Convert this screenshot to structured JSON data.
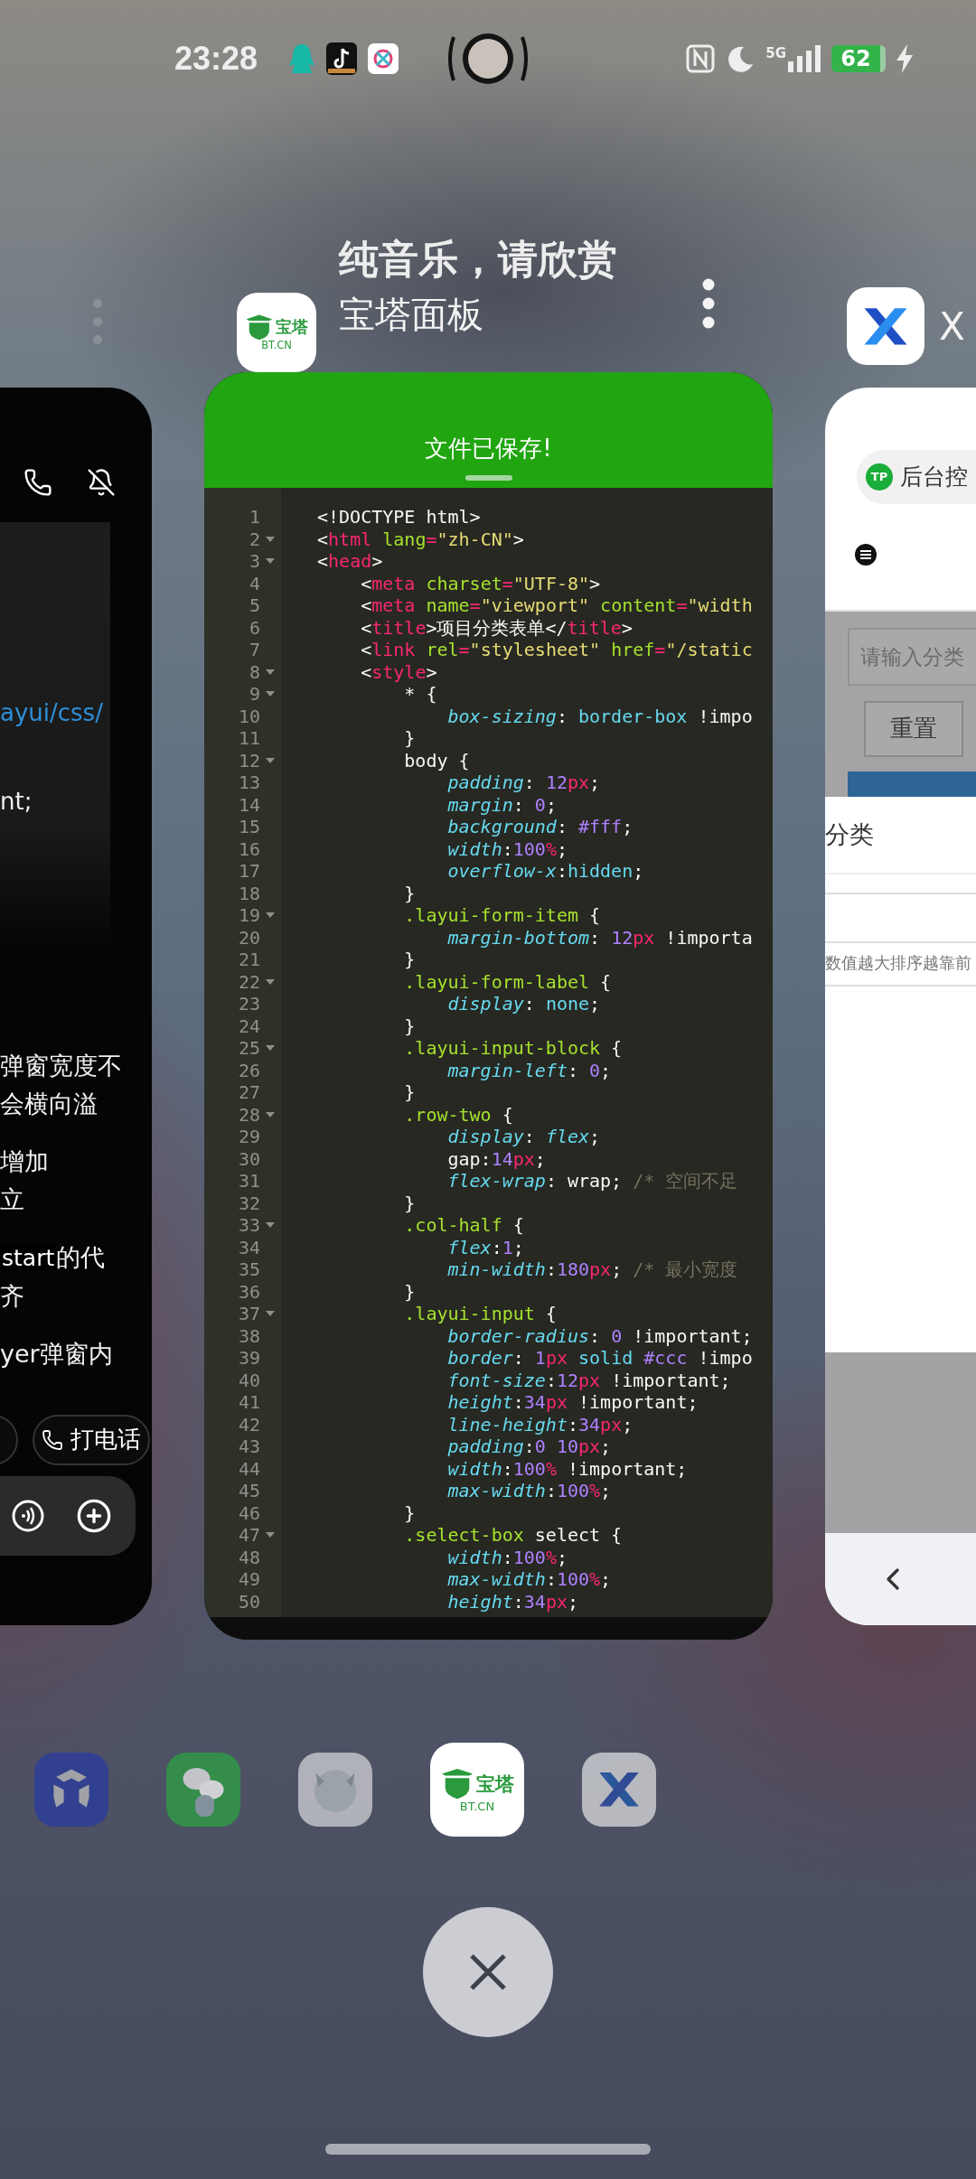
{
  "status_bar": {
    "time": "23:28",
    "network": "5G",
    "battery": "62"
  },
  "current_app": {
    "title": "纯音乐，请欣赏",
    "name": "宝塔面板",
    "icon_mark": "宝塔",
    "icon_domain": "BT.CN"
  },
  "next_app": {
    "name": "X"
  },
  "left_card": {
    "link_text": "ayui/css/",
    "code_tail": "nt;",
    "paragraphs": [
      [
        {
          "text": "弹窗宽度不"
        },
        {
          "text": "会横向溢"
        }
      ],
      [
        {
          "text": "增加"
        },
        {
          "text": "立"
        }
      ],
      [
        {
          "code": "start",
          "text": "的代"
        },
        {
          "text": "齐"
        }
      ],
      [
        {
          "text": "yer弹窗内"
        }
      ]
    ],
    "call_button": "打电话"
  },
  "editor": {
    "toast": "文件已保存!",
    "lines": [
      {
        "n": "1",
        "fold": false,
        "tokens": [
          {
            "kind": "plain",
            "text": "<!DOCTYPE html>"
          }
        ]
      },
      {
        "n": "2",
        "fold": true,
        "tokens": [
          {
            "kind": "plain",
            "text": "<"
          },
          {
            "kind": "tag",
            "text": "html"
          },
          {
            "kind": "attr",
            "text": " lang"
          },
          {
            "kind": "tag",
            "text": "="
          },
          {
            "kind": "str",
            "text": "\"zh-CN\""
          },
          {
            "kind": "plain",
            "text": ">"
          }
        ]
      },
      {
        "n": "3",
        "fold": true,
        "tokens": [
          {
            "kind": "plain",
            "text": "<"
          },
          {
            "kind": "tag",
            "text": "head"
          },
          {
            "kind": "plain",
            "text": ">"
          }
        ]
      },
      {
        "n": "4",
        "fold": false,
        "tokens": [
          {
            "kind": "plain",
            "text": "    <"
          },
          {
            "kind": "tag",
            "text": "meta"
          },
          {
            "kind": "attr",
            "text": " charset"
          },
          {
            "kind": "tag",
            "text": "="
          },
          {
            "kind": "str",
            "text": "\"UTF-8\""
          },
          {
            "kind": "plain",
            "text": ">"
          }
        ]
      },
      {
        "n": "5",
        "fold": false,
        "tokens": [
          {
            "kind": "plain",
            "text": "    <"
          },
          {
            "kind": "tag",
            "text": "meta"
          },
          {
            "kind": "attr",
            "text": " name"
          },
          {
            "kind": "tag",
            "text": "="
          },
          {
            "kind": "str",
            "text": "\"viewport\""
          },
          {
            "kind": "attr",
            "text": " content"
          },
          {
            "kind": "tag",
            "text": "="
          },
          {
            "kind": "str",
            "text": "\"width"
          }
        ]
      },
      {
        "n": "6",
        "fold": false,
        "tokens": [
          {
            "kind": "plain",
            "text": "    <"
          },
          {
            "kind": "tag",
            "text": "title"
          },
          {
            "kind": "plain",
            "text": ">项目分类表单</"
          },
          {
            "kind": "tag",
            "text": "title"
          },
          {
            "kind": "plain",
            "text": ">"
          }
        ]
      },
      {
        "n": "7",
        "fold": false,
        "tokens": [
          {
            "kind": "plain",
            "text": "    <"
          },
          {
            "kind": "tag",
            "text": "link"
          },
          {
            "kind": "attr",
            "text": " rel"
          },
          {
            "kind": "tag",
            "text": "="
          },
          {
            "kind": "str",
            "text": "\"stylesheet\""
          },
          {
            "kind": "attr",
            "text": " href"
          },
          {
            "kind": "tag",
            "text": "="
          },
          {
            "kind": "str",
            "text": "\"/static"
          }
        ]
      },
      {
        "n": "8",
        "fold": true,
        "tokens": [
          {
            "kind": "plain",
            "text": "    <"
          },
          {
            "kind": "tag",
            "text": "style"
          },
          {
            "kind": "plain",
            "text": ">"
          }
        ]
      },
      {
        "n": "9",
        "fold": true,
        "tokens": [
          {
            "kind": "plain",
            "text": "        * {"
          }
        ]
      },
      {
        "n": "10",
        "fold": false,
        "tokens": [
          {
            "kind": "prop",
            "text": "            box-sizing"
          },
          {
            "kind": "plain",
            "text": ": "
          },
          {
            "kind": "val",
            "text": "border-box"
          },
          {
            "kind": "plain",
            "text": " !impo"
          }
        ]
      },
      {
        "n": "11",
        "fold": false,
        "tokens": [
          {
            "kind": "plain",
            "text": "        }"
          }
        ]
      },
      {
        "n": "12",
        "fold": true,
        "tokens": [
          {
            "kind": "plain",
            "text": "        body {"
          }
        ]
      },
      {
        "n": "13",
        "fold": false,
        "tokens": [
          {
            "kind": "prop",
            "text": "            padding"
          },
          {
            "kind": "plain",
            "text": ": "
          },
          {
            "kind": "num",
            "text": "12"
          },
          {
            "kind": "unit",
            "text": "px"
          },
          {
            "kind": "plain",
            "text": ";"
          }
        ]
      },
      {
        "n": "14",
        "fold": false,
        "tokens": [
          {
            "kind": "prop",
            "text": "            margin"
          },
          {
            "kind": "plain",
            "text": ": "
          },
          {
            "kind": "num",
            "text": "0"
          },
          {
            "kind": "plain",
            "text": ";"
          }
        ]
      },
      {
        "n": "15",
        "fold": false,
        "tokens": [
          {
            "kind": "prop",
            "text": "            background"
          },
          {
            "kind": "plain",
            "text": ": "
          },
          {
            "kind": "num",
            "text": "#fff"
          },
          {
            "kind": "plain",
            "text": ";"
          }
        ]
      },
      {
        "n": "16",
        "fold": false,
        "tokens": [
          {
            "kind": "prop",
            "text": "            width"
          },
          {
            "kind": "plain",
            "text": ":"
          },
          {
            "kind": "num",
            "text": "100"
          },
          {
            "kind": "unit",
            "text": "%"
          },
          {
            "kind": "plain",
            "text": ";"
          }
        ]
      },
      {
        "n": "17",
        "fold": false,
        "tokens": [
          {
            "kind": "prop",
            "text": "            overflow-x"
          },
          {
            "kind": "plain",
            "text": ":"
          },
          {
            "kind": "val",
            "text": "hidden"
          },
          {
            "kind": "plain",
            "text": ";"
          }
        ]
      },
      {
        "n": "18",
        "fold": false,
        "tokens": [
          {
            "kind": "plain",
            "text": "        }"
          }
        ]
      },
      {
        "n": "19",
        "fold": true,
        "tokens": [
          {
            "kind": "sel",
            "text": "        .layui-form-item"
          },
          {
            "kind": "plain",
            "text": " {"
          }
        ]
      },
      {
        "n": "20",
        "fold": false,
        "tokens": [
          {
            "kind": "prop",
            "text": "            margin-bottom"
          },
          {
            "kind": "plain",
            "text": ": "
          },
          {
            "kind": "num",
            "text": "12"
          },
          {
            "kind": "unit",
            "text": "px"
          },
          {
            "kind": "plain",
            "text": " !importa"
          }
        ]
      },
      {
        "n": "21",
        "fold": false,
        "tokens": [
          {
            "kind": "plain",
            "text": "        }"
          }
        ]
      },
      {
        "n": "22",
        "fold": true,
        "tokens": [
          {
            "kind": "sel",
            "text": "        .layui-form-label"
          },
          {
            "kind": "plain",
            "text": " {"
          }
        ]
      },
      {
        "n": "23",
        "fold": false,
        "tokens": [
          {
            "kind": "prop",
            "text": "            display"
          },
          {
            "kind": "plain",
            "text": ": "
          },
          {
            "kind": "val",
            "text": "none"
          },
          {
            "kind": "plain",
            "text": ";"
          }
        ]
      },
      {
        "n": "24",
        "fold": false,
        "tokens": [
          {
            "kind": "plain",
            "text": "        }"
          }
        ]
      },
      {
        "n": "25",
        "fold": true,
        "tokens": [
          {
            "kind": "sel",
            "text": "        .layui-input-block"
          },
          {
            "kind": "plain",
            "text": " {"
          }
        ]
      },
      {
        "n": "26",
        "fold": false,
        "tokens": [
          {
            "kind": "prop",
            "text": "            margin-left"
          },
          {
            "kind": "plain",
            "text": ": "
          },
          {
            "kind": "num",
            "text": "0"
          },
          {
            "kind": "plain",
            "text": ";"
          }
        ]
      },
      {
        "n": "27",
        "fold": false,
        "tokens": [
          {
            "kind": "plain",
            "text": "        }"
          }
        ]
      },
      {
        "n": "28",
        "fold": true,
        "tokens": [
          {
            "kind": "sel",
            "text": "        .row-two"
          },
          {
            "kind": "plain",
            "text": " {"
          }
        ]
      },
      {
        "n": "29",
        "fold": false,
        "tokens": [
          {
            "kind": "prop",
            "text": "            display"
          },
          {
            "kind": "plain",
            "text": ": "
          },
          {
            "kind": "valit",
            "text": "flex"
          },
          {
            "kind": "plain",
            "text": ";"
          }
        ]
      },
      {
        "n": "30",
        "fold": false,
        "tokens": [
          {
            "kind": "plain",
            "text": "            gap:"
          },
          {
            "kind": "num",
            "text": "14"
          },
          {
            "kind": "unit",
            "text": "px"
          },
          {
            "kind": "plain",
            "text": ";"
          }
        ]
      },
      {
        "n": "31",
        "fold": false,
        "tokens": [
          {
            "kind": "prop",
            "text": "            flex-wrap"
          },
          {
            "kind": "plain",
            "text": ": wrap; "
          },
          {
            "kind": "com",
            "text": "/* 空间不足"
          }
        ]
      },
      {
        "n": "32",
        "fold": false,
        "tokens": [
          {
            "kind": "plain",
            "text": "        }"
          }
        ]
      },
      {
        "n": "33",
        "fold": true,
        "tokens": [
          {
            "kind": "sel",
            "text": "        .col-half"
          },
          {
            "kind": "plain",
            "text": " {"
          }
        ]
      },
      {
        "n": "34",
        "fold": false,
        "tokens": [
          {
            "kind": "prop",
            "text": "            flex"
          },
          {
            "kind": "plain",
            "text": ":"
          },
          {
            "kind": "num",
            "text": "1"
          },
          {
            "kind": "plain",
            "text": ";"
          }
        ]
      },
      {
        "n": "35",
        "fold": false,
        "tokens": [
          {
            "kind": "prop",
            "text": "            min-width"
          },
          {
            "kind": "plain",
            "text": ":"
          },
          {
            "kind": "num",
            "text": "180"
          },
          {
            "kind": "unit",
            "text": "px"
          },
          {
            "kind": "plain",
            "text": "; "
          },
          {
            "kind": "com",
            "text": "/* 最小宽度"
          }
        ]
      },
      {
        "n": "36",
        "fold": false,
        "tokens": [
          {
            "kind": "plain",
            "text": "        }"
          }
        ]
      },
      {
        "n": "37",
        "fold": true,
        "tokens": [
          {
            "kind": "sel",
            "text": "        .layui-input"
          },
          {
            "kind": "plain",
            "text": " {"
          }
        ]
      },
      {
        "n": "38",
        "fold": false,
        "tokens": [
          {
            "kind": "prop",
            "text": "            border-radius"
          },
          {
            "kind": "plain",
            "text": ": "
          },
          {
            "kind": "num",
            "text": "0"
          },
          {
            "kind": "plain",
            "text": " !important;"
          }
        ]
      },
      {
        "n": "39",
        "fold": false,
        "tokens": [
          {
            "kind": "prop",
            "text": "            border"
          },
          {
            "kind": "plain",
            "text": ": "
          },
          {
            "kind": "num",
            "text": "1"
          },
          {
            "kind": "unit",
            "text": "px"
          },
          {
            "kind": "val",
            "text": " solid"
          },
          {
            "kind": "num",
            "text": " #ccc"
          },
          {
            "kind": "plain",
            "text": " !impo"
          }
        ]
      },
      {
        "n": "40",
        "fold": false,
        "tokens": [
          {
            "kind": "prop",
            "text": "            font-size"
          },
          {
            "kind": "plain",
            "text": ":"
          },
          {
            "kind": "num",
            "text": "12"
          },
          {
            "kind": "unit",
            "text": "px"
          },
          {
            "kind": "plain",
            "text": " !important;"
          }
        ]
      },
      {
        "n": "41",
        "fold": false,
        "tokens": [
          {
            "kind": "prop",
            "text": "            height"
          },
          {
            "kind": "plain",
            "text": ":"
          },
          {
            "kind": "num",
            "text": "34"
          },
          {
            "kind": "unit",
            "text": "px"
          },
          {
            "kind": "plain",
            "text": " !important;"
          }
        ]
      },
      {
        "n": "42",
        "fold": false,
        "tokens": [
          {
            "kind": "prop",
            "text": "            line-height"
          },
          {
            "kind": "plain",
            "text": ":"
          },
          {
            "kind": "num",
            "text": "34"
          },
          {
            "kind": "unit",
            "text": "px"
          },
          {
            "kind": "plain",
            "text": ";"
          }
        ]
      },
      {
        "n": "43",
        "fold": false,
        "tokens": [
          {
            "kind": "prop",
            "text": "            padding"
          },
          {
            "kind": "plain",
            "text": ":"
          },
          {
            "kind": "num",
            "text": "0 10"
          },
          {
            "kind": "unit",
            "text": "px"
          },
          {
            "kind": "plain",
            "text": ";"
          }
        ]
      },
      {
        "n": "44",
        "fold": false,
        "tokens": [
          {
            "kind": "prop",
            "text": "            width"
          },
          {
            "kind": "plain",
            "text": ":"
          },
          {
            "kind": "num",
            "text": "100"
          },
          {
            "kind": "unit",
            "text": "%"
          },
          {
            "kind": "plain",
            "text": " !important;"
          }
        ]
      },
      {
        "n": "45",
        "fold": false,
        "tokens": [
          {
            "kind": "prop",
            "text": "            max-width"
          },
          {
            "kind": "plain",
            "text": ":"
          },
          {
            "kind": "num",
            "text": "100"
          },
          {
            "kind": "unit",
            "text": "%"
          },
          {
            "kind": "plain",
            "text": ";"
          }
        ]
      },
      {
        "n": "46",
        "fold": false,
        "tokens": [
          {
            "kind": "plain",
            "text": "        }"
          }
        ]
      },
      {
        "n": "47",
        "fold": true,
        "tokens": [
          {
            "kind": "sel",
            "text": "        .select-box"
          },
          {
            "kind": "plain",
            "text": " select {"
          }
        ]
      },
      {
        "n": "48",
        "fold": false,
        "tokens": [
          {
            "kind": "prop",
            "text": "            width"
          },
          {
            "kind": "plain",
            "text": ":"
          },
          {
            "kind": "num",
            "text": "100"
          },
          {
            "kind": "unit",
            "text": "%"
          },
          {
            "kind": "plain",
            "text": ";"
          }
        ]
      },
      {
        "n": "49",
        "fold": false,
        "tokens": [
          {
            "kind": "prop",
            "text": "            max-width"
          },
          {
            "kind": "plain",
            "text": ":"
          },
          {
            "kind": "num",
            "text": "100"
          },
          {
            "kind": "unit",
            "text": "%"
          },
          {
            "kind": "plain",
            "text": ";"
          }
        ]
      },
      {
        "n": "50",
        "fold": false,
        "tokens": [
          {
            "kind": "prop",
            "text": "            height"
          },
          {
            "kind": "plain",
            "text": ":"
          },
          {
            "kind": "num",
            "text": "34"
          },
          {
            "kind": "unit",
            "text": "px"
          },
          {
            "kind": "plain",
            "text": ";"
          }
        ]
      }
    ]
  },
  "right_card": {
    "tp_badge": "TP",
    "tab": "后台控",
    "search_placeholder": "请输入分类",
    "reset_button": "重置",
    "dialog_title": "分类",
    "hint": "数值越大排序越靠前"
  },
  "dock": [
    {
      "kind": "hexagon",
      "selected": false
    },
    {
      "kind": "chat",
      "selected": false
    },
    {
      "kind": "character",
      "selected": false
    },
    {
      "kind": "baota",
      "selected": true,
      "mark": "宝塔",
      "domain": "BT.CN"
    },
    {
      "kind": "x",
      "selected": false
    }
  ]
}
